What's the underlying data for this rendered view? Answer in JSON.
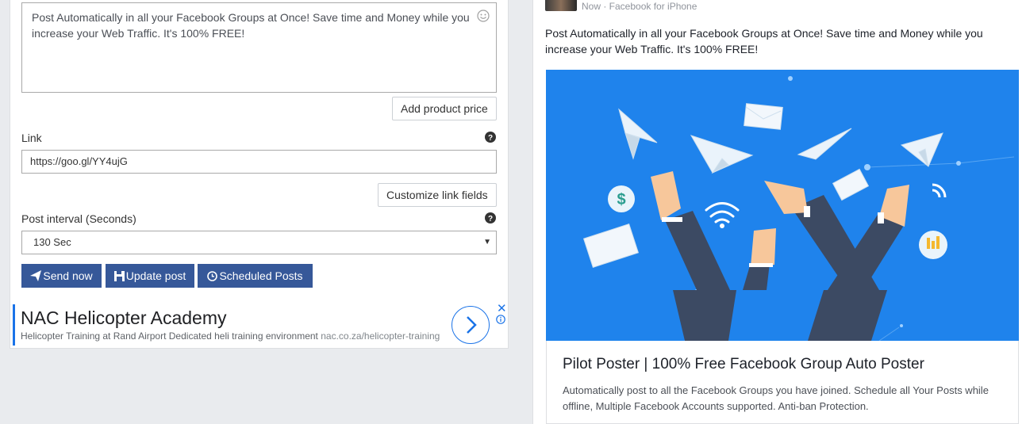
{
  "form": {
    "message": "Post Automatically in all your Facebook Groups at Once! Save time and Money while you increase your Web Traffic. It's 100% FREE!",
    "add_price_label": "Add product price",
    "link_label": "Link",
    "link_value": "https://goo.gl/YY4ujG",
    "customize_link_label": "Customize link fields",
    "interval_label": "Post interval (Seconds)",
    "interval_value": "130 Sec",
    "send_now_label": "Send now",
    "update_post_label": "Update post",
    "scheduled_posts_label": "Scheduled Posts"
  },
  "ad": {
    "title": "NAC Helicopter Academy",
    "description": "Helicopter Training at Rand Airport Dedicated heli training environment",
    "url": "nac.co.za/helicopter-training"
  },
  "preview": {
    "meta": "Now · Facebook for iPhone",
    "post_text": "Post Automatically in all your Facebook Groups at Once! Save time and Money while you increase your Web Traffic. It's 100% FREE!",
    "link_title": "Pilot Poster | 100% Free Facebook Group Auto Poster",
    "link_description": "Automatically post to all the Facebook Groups you have joined. Schedule all Your Posts while offline, Multiple Facebook Accounts supported. Anti-ban Protection.",
    "image_subject": "paper planes and hands illustration"
  },
  "colors": {
    "button_primary": "#365899",
    "image_background": "#1f83ec",
    "ad_accent": "#1a73e8"
  }
}
